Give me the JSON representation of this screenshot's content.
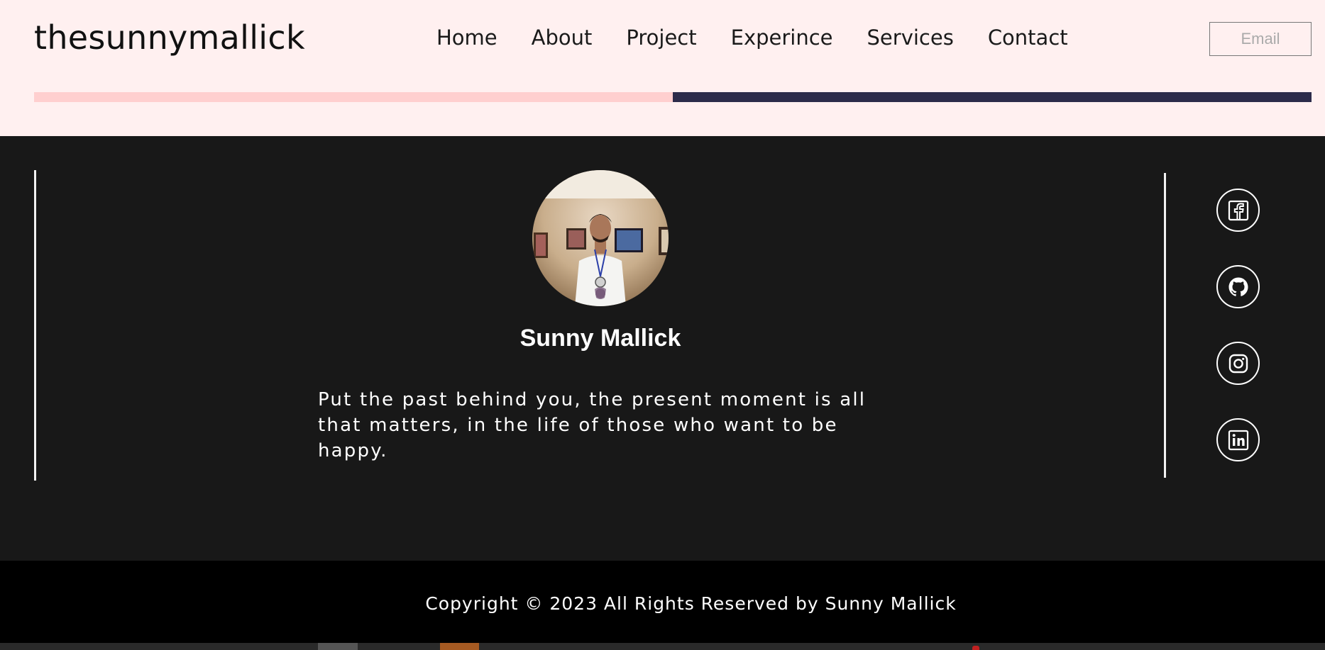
{
  "header": {
    "logo": "thesunnymallick",
    "nav": [
      "Home",
      "About",
      "Project",
      "Experince",
      "Services",
      "Contact"
    ],
    "email_placeholder": "Email",
    "scroll_progress_percent": 50
  },
  "profile": {
    "name": "Sunny Mallick",
    "quote": "Put the past behind you, the present moment is all that matters, in the life of those who want to be happy."
  },
  "social": [
    "facebook-icon",
    "github-icon",
    "instagram-icon",
    "linkedin-icon"
  ],
  "footer": {
    "copyright": "Copyright © 2023 All Rights Reserved by Sunny Mallick"
  },
  "colors": {
    "header_bg": "#fff0f0",
    "progress_fill": "#ffcfcf",
    "progress_track": "#2c2b4a",
    "main_bg": "#181818",
    "footer_bg": "#000000"
  }
}
